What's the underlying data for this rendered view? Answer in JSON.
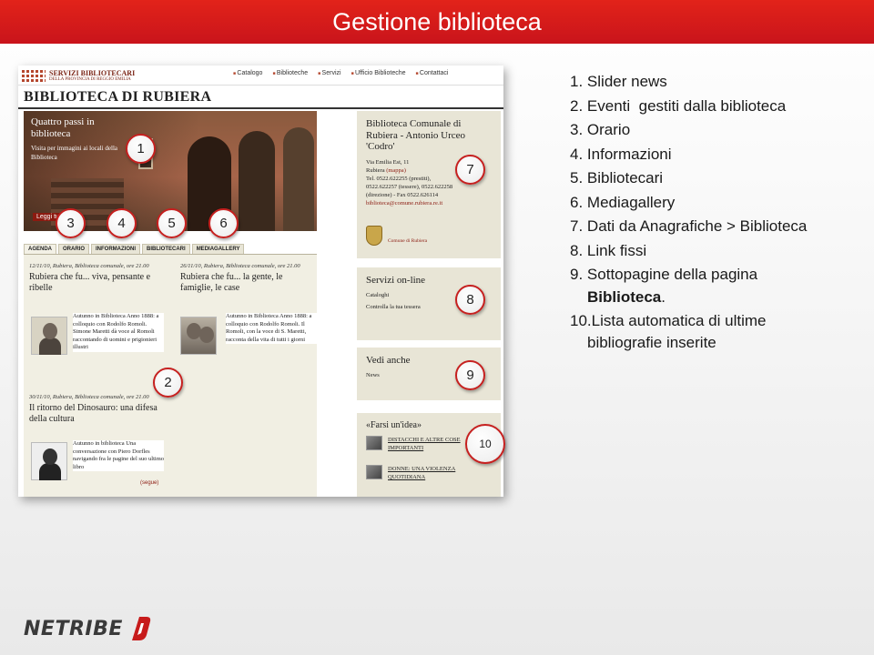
{
  "slide": {
    "title": "Gestione biblioteca",
    "accent_color": "#d51a1b"
  },
  "site": {
    "brand_line1": "SERVIZI BIBLIOTECARI",
    "brand_line2": "DELLA PROVINCIA DI REGGIO EMILIA",
    "nav": [
      "Catalogo",
      "Biblioteche",
      "Servizi",
      "Ufficio Biblioteche",
      "Contattaci"
    ],
    "name": "BIBLIOTECA DI RUBIERA",
    "slider": {
      "title": "Quattro passi in biblioteca",
      "subtitle": "Visita per immagini ai locali della Biblioteca",
      "button": "Leggi tu"
    },
    "tabs": [
      "AGENDA",
      "ORARIO",
      "INFORMAZIONI",
      "BIBLIOTECARI",
      "MEDIAGALLERY"
    ],
    "events": [
      {
        "date": "12/11/10, Rubiera, Biblioteca comunale, ore 21.00",
        "title": "Rubiera che fu... viva, pensante e ribelle",
        "body": "Autunno in Biblioteca Anno 1888: a colloquio con Rodolfo Romoli. Simone Maretti dà voce al Romoli raccontando di uomini e prigionieri illustri"
      },
      {
        "date": "26/11/10, Rubiera, Biblioteca comunale, ore 21.00",
        "title": "Rubiera che fu... la gente, le famiglie, le case",
        "body": "Autunno in Biblioteca Anno 1888: a colloquio con Rodolfo Romoli. Il Romoli, con la voce di S. Maretti, racconta della vita di tutti i giorni"
      },
      {
        "date": "30/11/10, Rubiera, Biblioteca comunale, ore 21.00",
        "title": "Il ritorno del Dinosauro: una difesa della cultura",
        "body": "Autunno in biblioteca Una conversazione con Piero Dorfles navigando fra le pagine del suo ultimo libro",
        "more": "(segue)"
      }
    ],
    "sidebar": {
      "library_title": "Biblioteca Comunale di Rubiera - Antonio Urceo 'Codro'",
      "address": "Via Emilia Est, 11",
      "city": "Rubiera",
      "map_link": "(mappa)",
      "phone_1": "Tel. 0522.622255 (prestiti),",
      "phone_2": "0522.622257 (tessere), 0522.622258",
      "phone_3": "(direzione) - Fax 0522.626114",
      "email": "biblioteca@comune.rubiera.re.it",
      "comune": "Comune di Rubiera",
      "services_title": "Servizi on-line",
      "services": [
        "Cataloghi",
        "Controlla la tua tessera"
      ],
      "see_also_title": "Vedi anche",
      "see_also": [
        "News"
      ],
      "ideas_title": "«Farsi un'idea»",
      "ideas": [
        "DISTACCHI E ALTRE COSE IMPORTANTI",
        "DONNE: UNA VIOLENZA QUOTIDIANA"
      ]
    }
  },
  "badges": [
    "1",
    "2",
    "3",
    "4",
    "5",
    "6",
    "7",
    "8",
    "9",
    "10"
  ],
  "legend": [
    {
      "num": "1.",
      "text": "Slider news"
    },
    {
      "num": "2.",
      "text": "Eventi  gestiti dalla biblioteca"
    },
    {
      "num": "3.",
      "text": "Orario"
    },
    {
      "num": "4.",
      "text": "Informazioni"
    },
    {
      "num": "5.",
      "text": "Bibliotecari"
    },
    {
      "num": "6.",
      "text": "Mediagallery"
    },
    {
      "num": "7.",
      "text": "Dati da Anagrafiche > Biblioteca"
    },
    {
      "num": "8.",
      "text": "Link fissi"
    },
    {
      "num": "9.",
      "text": "Sottopagine della pagina",
      "text_bold": "Biblioteca",
      "text_tail": "."
    },
    {
      "num": "10.",
      "text": "Lista automatica di ultime",
      "text2": "bibliografie inserite"
    }
  ],
  "footer": {
    "logo_text": "NETRIBE",
    "logo_mark": "d"
  }
}
